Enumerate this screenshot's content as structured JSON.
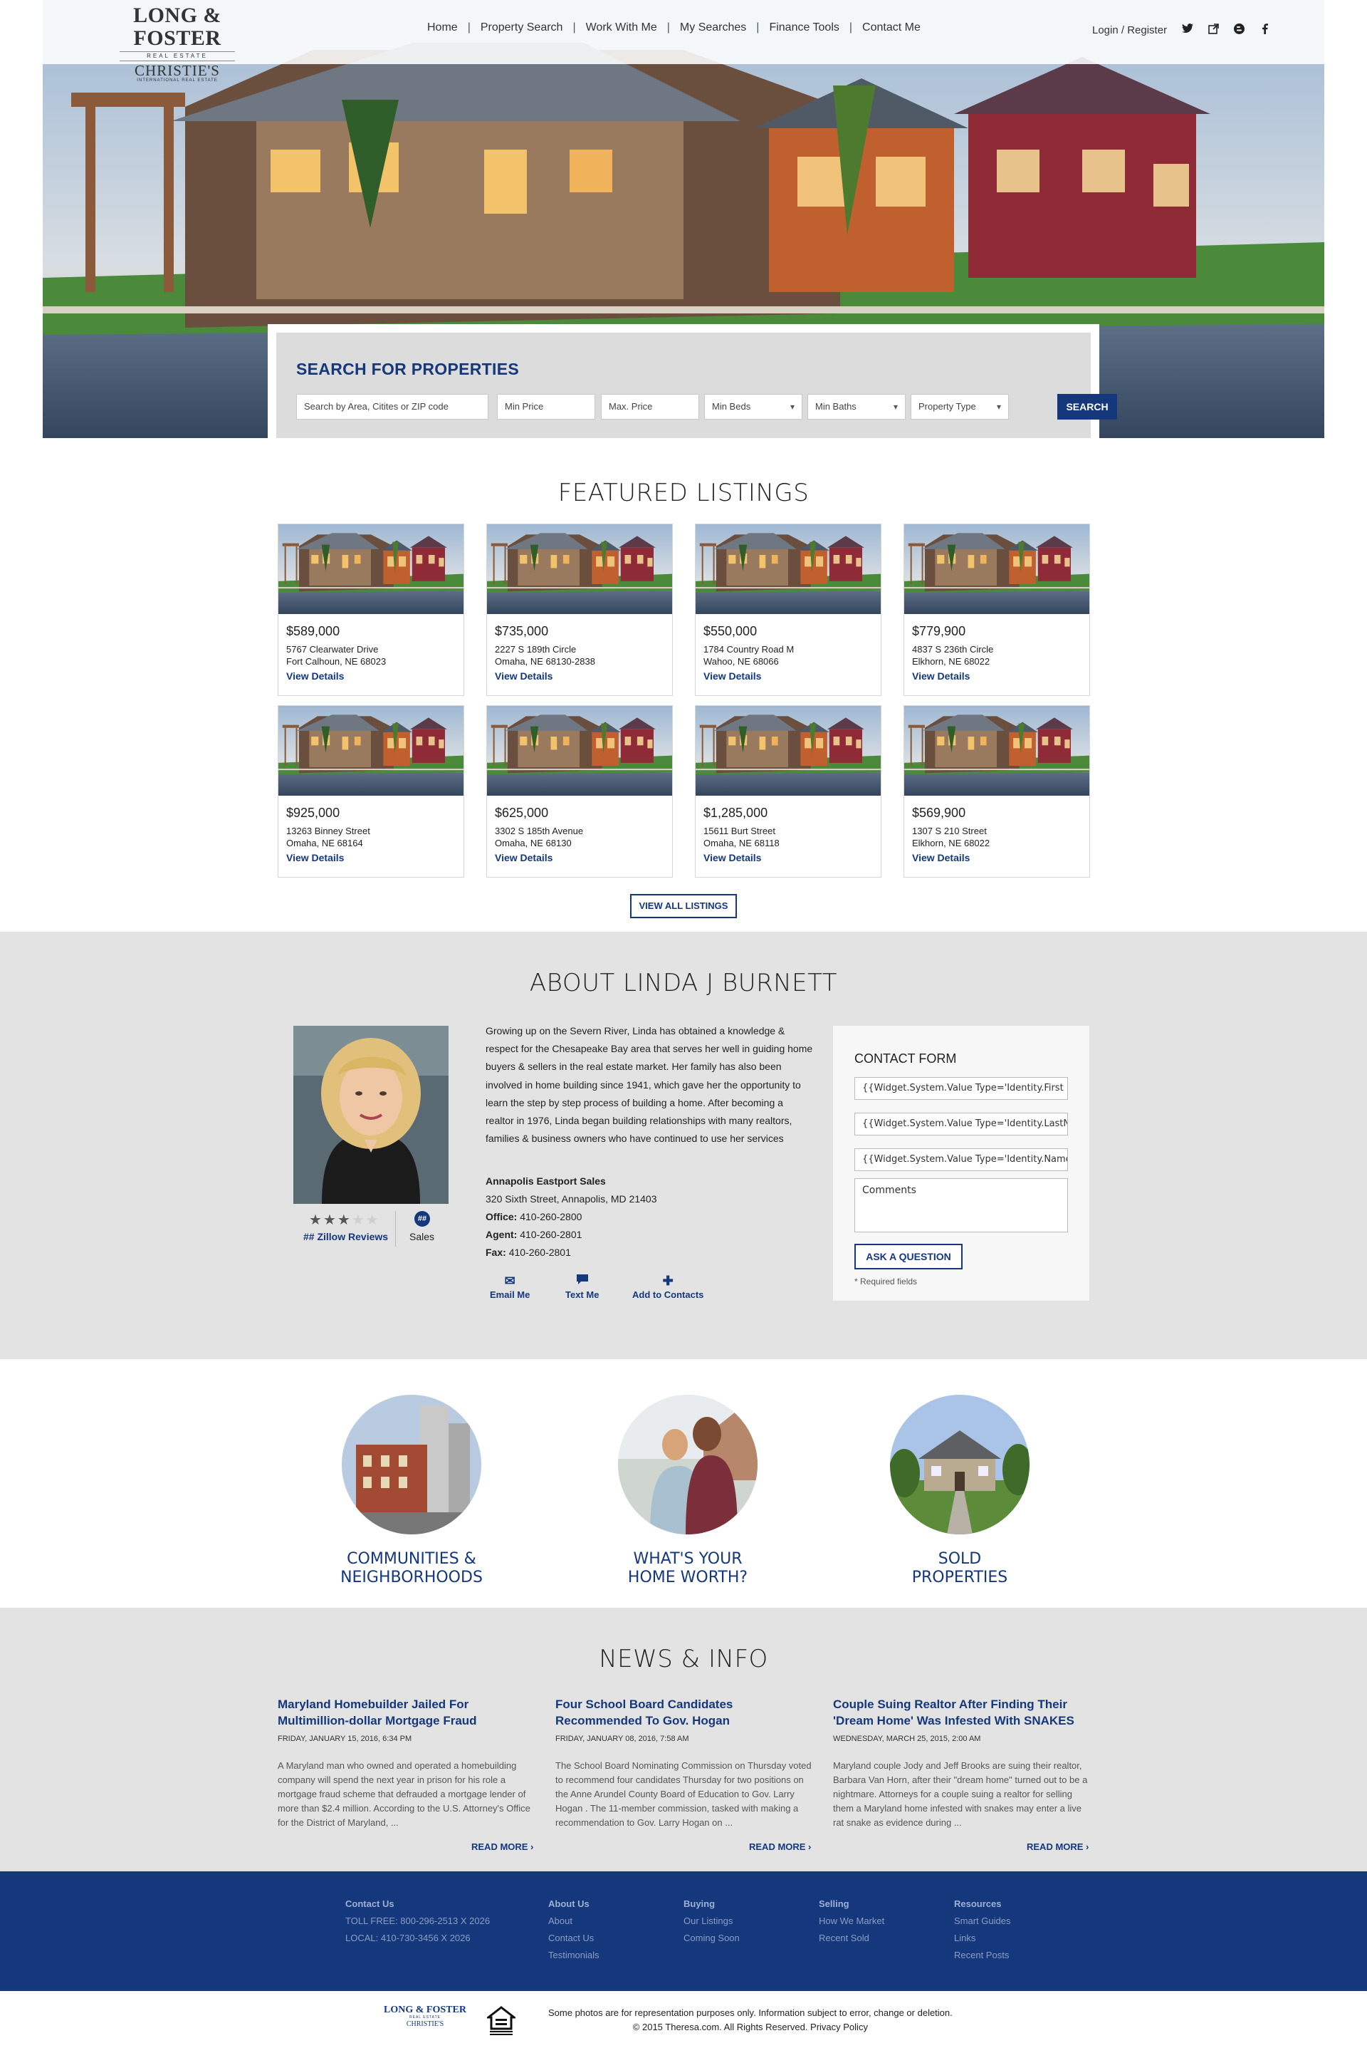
{
  "colors": {
    "brand_blue": "#15387d",
    "gray_section": "#e3e3e3",
    "white": "#ffffff"
  },
  "header": {
    "logo": {
      "brand": "LONG & FOSTER",
      "tagline": "REAL ESTATE",
      "partner": "CHRISTIE'S",
      "partner_sub": "INTERNATIONAL REAL ESTATE"
    },
    "nav": [
      "Home",
      "Property Search",
      "Work With Me",
      "My Searches",
      "Finance Tools",
      "Contact Me"
    ],
    "login_label": "Login / Register",
    "social_icons": [
      "twitter-icon",
      "share-icon",
      "blogger-icon",
      "facebook-icon"
    ]
  },
  "search": {
    "title": "SEARCH FOR PROPERTIES",
    "area_placeholder": "Search by Area, Citites or ZIP code",
    "min_price_placeholder": "Min Price",
    "max_price_placeholder": "Max. Price",
    "min_beds": "Min Beds",
    "min_baths": "Min Baths",
    "property_type": "Property Type",
    "button": "SEARCH"
  },
  "featured": {
    "title": "FEATURED LISTINGS",
    "view_details_label": "View Details",
    "listings": [
      {
        "price": "$589,000",
        "street": "5767 Clearwater Drive",
        "city": "Fort Calhoun, NE 68023"
      },
      {
        "price": "$735,000",
        "street": "2227 S 189th Circle",
        "city": "Omaha, NE 68130-2838"
      },
      {
        "price": "$550,000",
        "street": "1784 Country Road M",
        "city": "Wahoo, NE 68066"
      },
      {
        "price": "$779,900",
        "street": "4837 S 236th Circle",
        "city": "Elkhorn, NE 68022"
      },
      {
        "price": "$925,000",
        "street": "13263 Binney Street",
        "city": "Omaha, NE 68164"
      },
      {
        "price": "$625,000",
        "street": "3302 S 185th Avenue",
        "city": "Omaha, NE 68130"
      },
      {
        "price": "$1,285,000",
        "street": "15611 Burt Street",
        "city": "Omaha, NE 68118"
      },
      {
        "price": "$569,900",
        "street": "1307 S 210 Street",
        "city": "Elkhorn, NE 68022"
      }
    ],
    "view_all": "VIEW ALL LISTINGS"
  },
  "about": {
    "title": "ABOUT LINDA J BURNETT",
    "rating_stars": 3,
    "rating_max": 5,
    "zillow_label": "## Zillow Reviews",
    "sales_badge": "##",
    "sales_label": "Sales",
    "bio": "Growing up on the Severn River, Linda has obtained a knowledge & respect for the Chesapeake Bay area that serves her well in guiding home buyers & sellers in the real estate market. Her family has also been involved in home building since 1941, which gave her the opportunity to learn the step by step process of building a home. After becoming a realtor in 1976, Linda began building relationships with many realtors, families & business owners who have continued to use her services",
    "office_name": "Annapolis Eastport Sales",
    "office_address": "320 Sixth Street, Annapolis, MD 21403",
    "office_label": "Office:",
    "office_phone": "410-260-2800",
    "agent_label": "Agent:",
    "agent_phone": "410-260-2801",
    "fax_label": "Fax:",
    "fax_phone": "410-260-2801",
    "actions": {
      "email": "Email Me",
      "text": "Text Me",
      "add": "Add to Contacts"
    }
  },
  "contact_form": {
    "title": "CONTACT FORM",
    "field1": "{{Widget.System.Value Type='Identity.First",
    "field2": "{{Widget.System.Value Type='Identity.LastName",
    "field3": "{{Widget.System.Value Type='Identity.Name",
    "comments_placeholder": "Comments",
    "button": "ASK A QUESTION",
    "note": "* Required fields"
  },
  "features": [
    {
      "line1": "COMMUNITIES &",
      "line2": "NEIGHBORHOODS"
    },
    {
      "line1": "WHAT'S YOUR",
      "line2": "HOME WORTH?"
    },
    {
      "line1": "SOLD",
      "line2": "PROPERTIES"
    }
  ],
  "news": {
    "title": "NEWS & INFO",
    "read_more": "READ MORE ›",
    "articles": [
      {
        "headline": "Maryland Homebuilder Jailed For Multimillion-dollar Mortgage Fraud",
        "date": "FRIDAY, JANUARY 15, 2016, 6:34 PM",
        "excerpt": "A Maryland man who owned and operated a homebuilding company will spend the next year in prison for his role a mortgage fraud scheme that defrauded a mortgage lender of more than $2.4 million. According to the U.S. Attorney's Office for the District of Maryland, ..."
      },
      {
        "headline": "Four School Board Candidates Recommended To Gov. Hogan",
        "date": "FRIDAY, JANUARY 08, 2016, 7:58 AM",
        "excerpt": "The School Board Nominating Commission on Thursday voted to recommend four candidates Thursday for two positions on the Anne Arundel County Board of Education to Gov. Larry Hogan . The 11-member commission, tasked with making a recommendation to Gov. Larry Hogan on ..."
      },
      {
        "headline": "Couple Suing Realtor After Finding Their 'Dream Home' Was Infested With SNAKES",
        "date": "WEDNESDAY, MARCH 25, 2015, 2:00 AM",
        "excerpt": "Maryland couple Jody and Jeff Brooks are suing their realtor, Barbara Van Horn, after their \"dream home\" turned out to be a nightmare. Attorneys for a couple suing a realtor for selling them a Maryland home infested with snakes may enter a live rat snake as evidence during ..."
      }
    ]
  },
  "footer": {
    "contact": {
      "heading": "Contact Us",
      "toll_free": "TOLL FREE: 800-296-2513 X 2026",
      "local": "LOCAL: 410-730-3456 X 2026"
    },
    "about": {
      "heading": "About Us",
      "links": [
        "About",
        "Contact Us",
        "Testimonials"
      ]
    },
    "buying": {
      "heading": "Buying",
      "links": [
        "Our Listings",
        "Coming Soon"
      ]
    },
    "selling": {
      "heading": "Selling",
      "links": [
        "How We Market",
        "Recent Sold"
      ]
    },
    "resources": {
      "heading": "Resources",
      "links": [
        "Smart Guides",
        "Links",
        "Recent Posts"
      ]
    },
    "legal_line1": "Some photos are for representation purposes only. Information subject to error, change or deletion.",
    "legal_line2": "© 2015 Theresa.com. All Rights Reserved. Privacy Policy",
    "logo": {
      "brand": "LONG & FOSTER",
      "tagline": "REAL ESTATE",
      "partner": "CHRISTIE'S"
    }
  }
}
